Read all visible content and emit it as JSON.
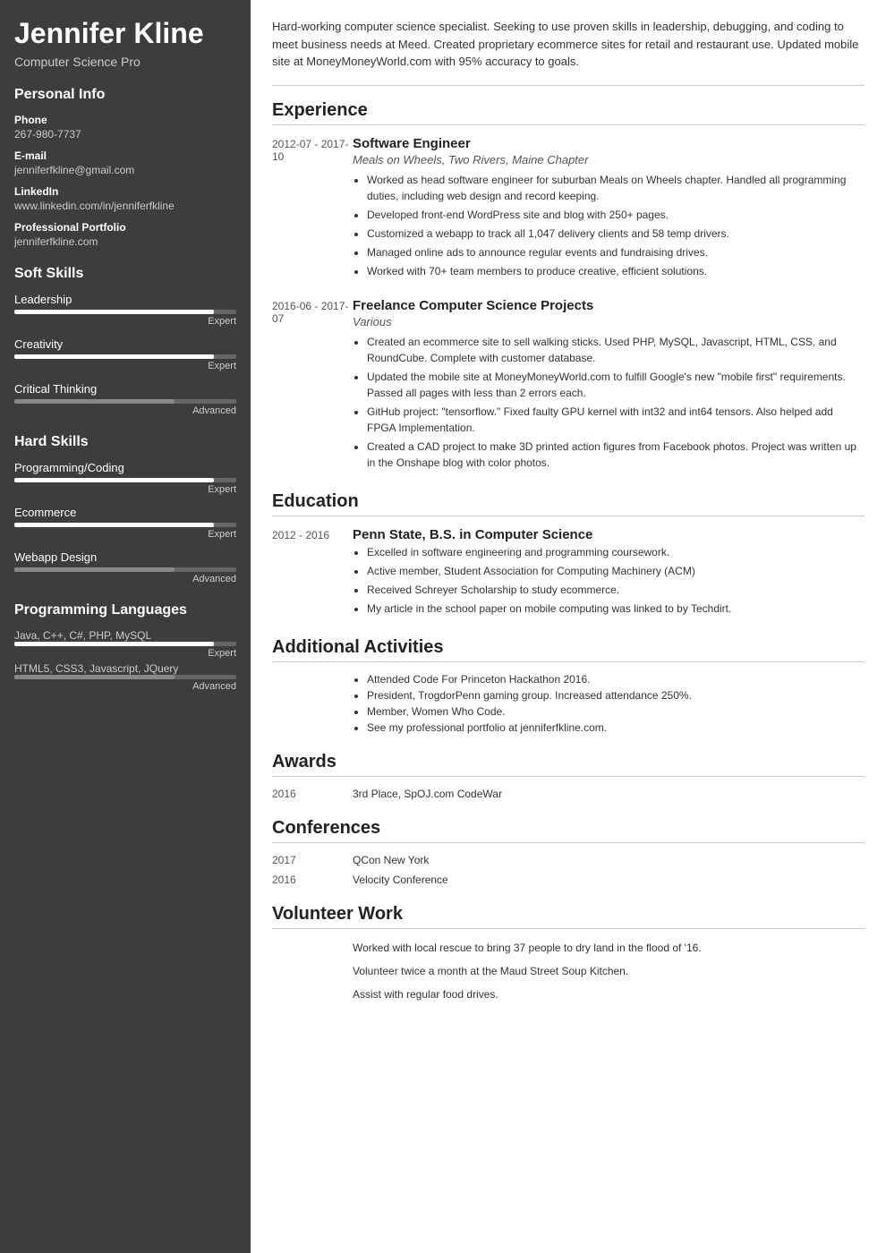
{
  "sidebar": {
    "name": "Jennifer Kline",
    "title": "Computer Science Pro",
    "personal_info": {
      "section_title": "Personal Info",
      "fields": [
        {
          "label": "Phone",
          "value": "267-980-7737"
        },
        {
          "label": "E-mail",
          "value": "jenniferfkline@gmail.com"
        },
        {
          "label": "LinkedIn",
          "value": "www.linkedin.com/in/jenniferfkline"
        },
        {
          "label": "Professional Portfolio",
          "value": "jenniferfkline.com"
        }
      ]
    },
    "soft_skills": {
      "section_title": "Soft Skills",
      "items": [
        {
          "name": "Leadership",
          "level": "Expert",
          "fill": "expert"
        },
        {
          "name": "Creativity",
          "level": "Expert",
          "fill": "expert"
        },
        {
          "name": "Critical Thinking",
          "level": "Advanced",
          "fill": "advanced"
        }
      ]
    },
    "hard_skills": {
      "section_title": "Hard Skills",
      "items": [
        {
          "name": "Programming/Coding",
          "level": "Expert",
          "fill": "expert"
        },
        {
          "name": "Ecommerce",
          "level": "Expert",
          "fill": "expert"
        },
        {
          "name": "Webapp Design",
          "level": "Advanced",
          "fill": "advanced"
        }
      ]
    },
    "programming_languages": {
      "section_title": "Programming Languages",
      "items": [
        {
          "name": "Java, C++, C#, PHP, MySQL",
          "level": "Expert",
          "fill": "expert"
        },
        {
          "name": "HTML5, CSS3, Javascript, JQuery",
          "level": "Advanced",
          "fill": "advanced"
        }
      ]
    }
  },
  "main": {
    "summary": "Hard-working computer science specialist. Seeking to use proven skills in leadership, debugging, and coding to meet business needs at Meed. Created proprietary ecommerce sites for retail and restaurant use. Updated mobile site at MoneyMoneyWorld.com with 95% accuracy to goals.",
    "experience": {
      "section_title": "Experience",
      "entries": [
        {
          "date": "2012-07 - 2017-10",
          "title": "Software Engineer",
          "subtitle": "Meals on Wheels, Two Rivers, Maine Chapter",
          "bullets": [
            "Worked as head software engineer for suburban Meals on Wheels chapter. Handled all programming duties, including web design and record keeping.",
            "Developed front-end WordPress site and blog with 250+ pages.",
            "Customized a webapp to track all 1,047 delivery clients and 58 temp drivers.",
            "Managed online ads to announce regular events and fundraising drives.",
            "Worked with 70+ team members to produce creative, efficient solutions."
          ]
        },
        {
          "date": "2016-06 - 2017-07",
          "title": "Freelance Computer Science Projects",
          "subtitle": "Various",
          "bullets": [
            "Created an ecommerce site to sell walking sticks. Used PHP, MySQL, Javascript, HTML, CSS, and RoundCube. Complete with customer database.",
            "Updated the mobile site at MoneyMoneyWorld.com to fulfill Google's new \"mobile first\" requirements. Passed all pages with less than 2 errors each.",
            "GitHub project: \"tensorflow.\" Fixed faulty GPU kernel with int32 and int64 tensors. Also helped add FPGA Implementation.",
            "Created a CAD project to make 3D printed action figures from Facebook photos. Project was written up in the Onshape blog with color photos."
          ]
        }
      ]
    },
    "education": {
      "section_title": "Education",
      "entries": [
        {
          "date": "2012 - 2016",
          "title": "Penn State, B.S. in Computer Science",
          "bullets": [
            "Excelled in software engineering and programming coursework.",
            "Active member, Student Association for Computing Machinery (ACM)",
            "Received Schreyer Scholarship to study ecommerce.",
            "My article in the school paper on mobile computing was linked to by Techdirt."
          ]
        }
      ]
    },
    "additional_activities": {
      "section_title": "Additional Activities",
      "bullets": [
        "Attended Code For Princeton Hackathon 2016.",
        "President, TrogdorPenn gaming group. Increased attendance 250%.",
        "Member, Women Who Code.",
        "See my professional portfolio at jenniferfkline.com."
      ]
    },
    "awards": {
      "section_title": "Awards",
      "entries": [
        {
          "year": "2016",
          "text": "3rd Place, SpOJ.com CodeWar"
        }
      ]
    },
    "conferences": {
      "section_title": "Conferences",
      "entries": [
        {
          "year": "2017",
          "text": "QCon New York"
        },
        {
          "year": "2016",
          "text": "Velocity Conference"
        }
      ]
    },
    "volunteer": {
      "section_title": "Volunteer Work",
      "items": [
        "Worked with local rescue to bring 37 people to dry land in the flood of '16.",
        "Volunteer twice a month at the Maud Street Soup Kitchen.",
        "Assist with regular food drives."
      ]
    }
  }
}
